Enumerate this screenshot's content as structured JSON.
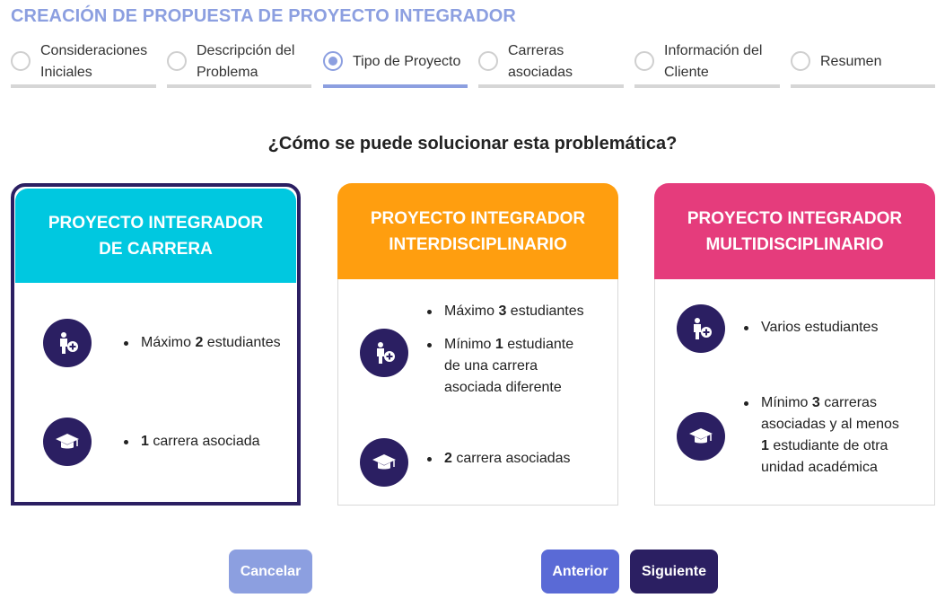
{
  "page": {
    "title": "CREACIÓN DE PROPUESTA DE PROYECTO INTEGRADOR"
  },
  "stepper": {
    "steps": [
      {
        "label": "Consideraciones Iniciales",
        "active": false
      },
      {
        "label": "Descripción del Problema",
        "active": false
      },
      {
        "label": "Tipo de Proyecto",
        "active": true
      },
      {
        "label": "Carreras asociadas",
        "active": false
      },
      {
        "label": "Información del Cliente",
        "active": false
      },
      {
        "label": "Resumen",
        "active": false
      }
    ]
  },
  "question": "¿Cómo se puede solucionar esta problemática?",
  "cards": [
    {
      "title": "PROYECTO INTEGRADOR DE CARRERA",
      "color": "#00c8e0",
      "selected": true,
      "students": [
        {
          "pre": "Máximo ",
          "bold": "2",
          "post": " estudiantes"
        }
      ],
      "careers": [
        {
          "pre": "",
          "bold": "1",
          "post": " carrera asociada"
        }
      ]
    },
    {
      "title": "PROYECTO INTEGRADOR INTERDISCIPLINARIO",
      "color": "#ff9e0f",
      "selected": false,
      "students": [
        {
          "pre": "Máximo ",
          "bold": "3",
          "post": " estudiantes"
        },
        {
          "pre": "Mínimo ",
          "bold": "1",
          "post": " estudiante de una carrera asociada diferente"
        }
      ],
      "careers": [
        {
          "pre": "",
          "bold": "2",
          "post": " carrera asociadas"
        }
      ]
    },
    {
      "title": "PROYECTO INTEGRADOR MULTIDISCIPLINARIO",
      "color": "#e53c7c",
      "selected": false,
      "students": [
        {
          "pre": "Varios estudiantes",
          "bold": "",
          "post": ""
        }
      ],
      "careers": [
        {
          "pre": "Mínimo ",
          "bold": "3",
          "post": " carreras asociadas y al menos ",
          "bold2": "1",
          "post2": " estudiante de otra unidad académica"
        }
      ]
    }
  ],
  "buttons": {
    "cancel": "Cancelar",
    "previous": "Anterior",
    "next": "Siguiente"
  },
  "colors": {
    "accent": "#8c9fe0",
    "selected_border": "#2b1f62",
    "icon_bg": "#2b1f62",
    "cancel_bg": "#8c9fe0",
    "previous_bg": "#5a6ad6",
    "next_bg": "#2b1f62"
  },
  "icons": {
    "students": "person-add-icon",
    "careers": "graduation-cap-icon"
  }
}
